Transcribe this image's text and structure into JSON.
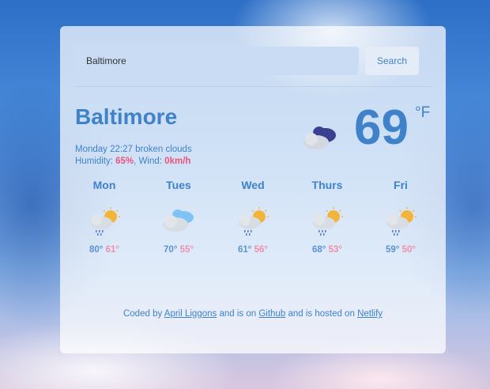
{
  "search": {
    "value": "Baltimore",
    "button_label": "Search"
  },
  "current": {
    "city": "Baltimore",
    "datetime": "Monday 22:27",
    "description": "broken clouds",
    "humidity_label": "Humidity:",
    "humidity": "65%",
    "wind_label": ", Wind:",
    "wind": "0km/h",
    "temperature": "69",
    "unit": "°F",
    "icon": "broken-clouds-icon"
  },
  "forecast": [
    {
      "day": "Mon",
      "high": "80°",
      "low": "61°",
      "icon": "rain-sun-icon"
    },
    {
      "day": "Tues",
      "high": "70°",
      "low": "55°",
      "icon": "clouds-icon"
    },
    {
      "day": "Wed",
      "high": "61°",
      "low": "56°",
      "icon": "rain-sun-icon"
    },
    {
      "day": "Thurs",
      "high": "68°",
      "low": "53°",
      "icon": "rain-sun-icon"
    },
    {
      "day": "Fri",
      "high": "59°",
      "low": "50°",
      "icon": "rain-sun-icon"
    }
  ],
  "footer": {
    "prefix": "Coded by",
    "author": "April Liggons",
    "middle": "and is on",
    "repo": "Github",
    "suffix": "and is hosted on",
    "host": "Netlify"
  },
  "colors": {
    "accent": "#3f82c9",
    "hot": "#e8547f",
    "low_temp": "#ee8fad",
    "high_temp": "#5b93cf"
  }
}
